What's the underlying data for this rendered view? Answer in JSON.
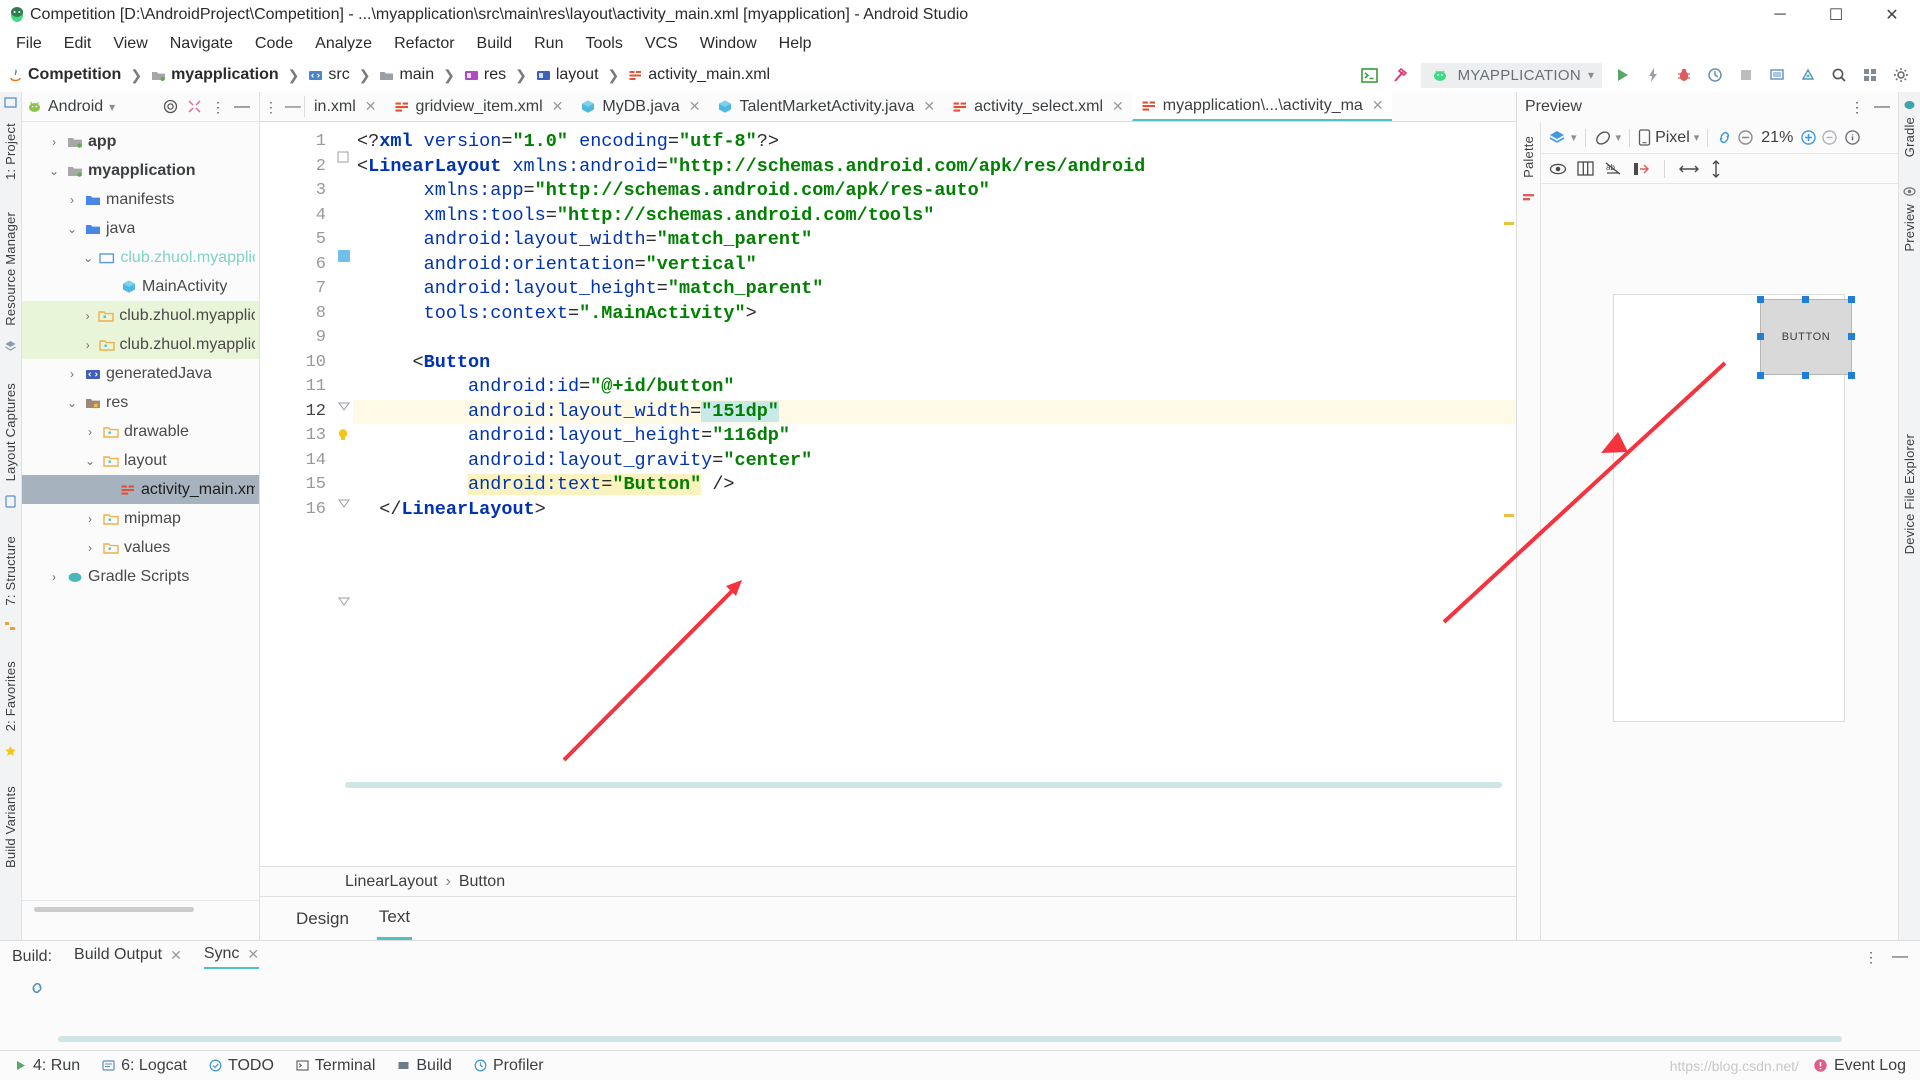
{
  "window": {
    "title": "Competition [D:\\AndroidProject\\Competition] - ...\\myapplication\\src\\main\\res\\layout\\activity_main.xml [myapplication] - Android Studio",
    "minimize_label": "─",
    "maximize_label": "☐",
    "close_label": "✕"
  },
  "menu": {
    "items": [
      {
        "label": "File"
      },
      {
        "label": "Edit"
      },
      {
        "label": "View"
      },
      {
        "label": "Navigate"
      },
      {
        "label": "Code"
      },
      {
        "label": "Analyze"
      },
      {
        "label": "Refactor"
      },
      {
        "label": "Build"
      },
      {
        "label": "Run"
      },
      {
        "label": "Tools"
      },
      {
        "label": "VCS"
      },
      {
        "label": "Window"
      },
      {
        "label": "Help"
      }
    ]
  },
  "breadcrumb": {
    "items": [
      {
        "label": "Competition",
        "icon": "java-icon",
        "bold": true
      },
      {
        "label": "myapplication",
        "icon": "module-icon",
        "bold": true
      },
      {
        "label": "src",
        "icon": "source-folder-icon",
        "bold": false
      },
      {
        "label": "main",
        "icon": "folder-icon",
        "bold": false
      },
      {
        "label": "res",
        "icon": "res-folder-icon",
        "bold": false
      },
      {
        "label": "layout",
        "icon": "layout-folder-icon",
        "bold": false
      },
      {
        "label": "activity_main.xml",
        "icon": "xml-file-icon",
        "bold": false
      }
    ]
  },
  "toolbar": {
    "terminal_icon": "terminal-icon",
    "gradle_icon": "gradle-hammer-icon",
    "device_name": "MYAPPLICATION",
    "device_icon": "android-head-icon",
    "run_icon": "run-play-icon",
    "apply_changes_icon": "lightning-icon",
    "debug_icon": "debug-bug-icon",
    "profile_icon": "profile-icon",
    "stop_icon": "stop-square-icon",
    "avd_icon": "avd-manager-icon",
    "sdk_icon": "sdk-manager-icon",
    "search_icon": "search-icon",
    "layout_icon": "layout-grid-icon",
    "settings_icon": "gear-icon"
  },
  "project_panel": {
    "title": "Android",
    "dropdown_icon": "chevron-down-icon",
    "target_icon": "target-locate-icon",
    "collapse_icon": "collapse-all-icon",
    "more_icon": "more-vertical-icon",
    "hide_icon": "hide-panel-icon",
    "tree": [
      {
        "label": "app",
        "indent": 1,
        "twisty": "›",
        "icon": "module-icon",
        "bold": true,
        "state": "normal"
      },
      {
        "label": "myapplication",
        "indent": 1,
        "twisty": "⌄",
        "icon": "module-icon",
        "bold": true,
        "state": "normal"
      },
      {
        "label": "manifests",
        "indent": 2,
        "twisty": "›",
        "icon": "folder-blue-icon",
        "bold": false,
        "state": "normal"
      },
      {
        "label": "java",
        "indent": 2,
        "twisty": "⌄",
        "icon": "folder-blue-icon",
        "bold": false,
        "state": "normal"
      },
      {
        "label": "club.zhuol.myapplication",
        "indent": 3,
        "twisty": "⌄",
        "icon": "package-icon",
        "bold": false,
        "state": "pkg"
      },
      {
        "label": "MainActivity",
        "indent": 4,
        "twisty": "",
        "icon": "java-class-icon",
        "bold": false,
        "state": "normal"
      },
      {
        "label": "club.zhuol.myapplication (a",
        "indent": 3,
        "twisty": "›",
        "icon": "folder-orange-icon",
        "bold": false,
        "state": "highlight"
      },
      {
        "label": "club.zhuol.myapplication (t",
        "indent": 3,
        "twisty": "›",
        "icon": "folder-orange-icon",
        "bold": false,
        "state": "highlight"
      },
      {
        "label": "generatedJava",
        "indent": 2,
        "twisty": "›",
        "icon": "source-folder-icon",
        "bold": false,
        "state": "normal"
      },
      {
        "label": "res",
        "indent": 2,
        "twisty": "⌄",
        "icon": "res-folder-icon",
        "bold": false,
        "state": "normal"
      },
      {
        "label": "drawable",
        "indent": 3,
        "twisty": "›",
        "icon": "folder-orange-icon",
        "bold": false,
        "state": "normal"
      },
      {
        "label": "layout",
        "indent": 3,
        "twisty": "⌄",
        "icon": "folder-orange-icon",
        "bold": false,
        "state": "normal"
      },
      {
        "label": "activity_main.xml",
        "indent": 4,
        "twisty": "",
        "icon": "xml-file-icon",
        "bold": false,
        "state": "selected"
      },
      {
        "label": "mipmap",
        "indent": 3,
        "twisty": "›",
        "icon": "folder-orange-icon",
        "bold": false,
        "state": "normal"
      },
      {
        "label": "values",
        "indent": 3,
        "twisty": "›",
        "icon": "folder-orange-icon",
        "bold": false,
        "state": "normal"
      },
      {
        "label": "Gradle Scripts",
        "indent": 1,
        "twisty": "›",
        "icon": "gradle-elephant-icon",
        "bold": false,
        "state": "normal"
      }
    ]
  },
  "left_strip": {
    "project_label": "1: Project",
    "resource_manager_label": "Resource Manager",
    "layout_captures_label": "Layout Captures",
    "structure_label": "7: Structure",
    "favorites_label": "2: Favorites",
    "build_variants_label": "Build Variants"
  },
  "right_strip": {
    "gradle_label": "Gradle",
    "preview_label": "Preview",
    "device_file_explorer_label": "Device File Explorer"
  },
  "editor_tabs": [
    {
      "label": "in.xml",
      "icon": "xml-file-icon",
      "active": false,
      "truncated": true
    },
    {
      "label": "gridview_item.xml",
      "icon": "xml-file-icon",
      "active": false
    },
    {
      "label": "MyDB.java",
      "icon": "java-class-icon",
      "active": false
    },
    {
      "label": "TalentMarketActivity.java",
      "icon": "java-class-icon",
      "active": false
    },
    {
      "label": "activity_select.xml",
      "icon": "xml-file-icon",
      "active": false
    },
    {
      "label": "myapplication\\...\\activity_ma",
      "icon": "xml-file-icon",
      "active": true
    }
  ],
  "editor": {
    "lines": [
      {
        "n": 1,
        "html": "<span class='punct'>&lt;?</span><span class='tag'>xml</span> <span class='attr'>version</span><span class='punct'>=</span><span class='str'>\"1.0\"</span> <span class='attr'>encoding</span><span class='punct'>=</span><span class='str'>\"utf-8\"</span><span class='punct'>?&gt;</span>"
      },
      {
        "n": 2,
        "html": "<span class='punct'>&lt;</span><span class='tag'>LinearLayout</span> <span class='attr'>xmlns:android</span><span class='punct'>=</span><span class='str'>\"http://schemas.android.com/apk/res/android</span>"
      },
      {
        "n": 3,
        "html": "      <span class='attr'>xmlns:app</span><span class='punct'>=</span><span class='str'>\"http://schemas.android.com/apk/res-auto\"</span>"
      },
      {
        "n": 4,
        "html": "      <span class='attr'>xmlns:tools</span><span class='punct'>=</span><span class='str'>\"http://schemas.android.com/tools\"</span>"
      },
      {
        "n": 5,
        "html": "      <span class='attr'>android:layout_width</span><span class='punct'>=</span><span class='str'>\"match_parent\"</span>"
      },
      {
        "n": 6,
        "html": "      <span class='attr'>android:orientation</span><span class='punct'>=</span><span class='str'>\"vertical\"</span>"
      },
      {
        "n": 7,
        "html": "      <span class='attr'>android:layout_height</span><span class='punct'>=</span><span class='str'>\"match_parent\"</span>"
      },
      {
        "n": 8,
        "html": "      <span class='attr'>tools:context</span><span class='punct'>=</span><span class='str'>\".MainActivity\"</span><span class='punct'>&gt;</span>"
      },
      {
        "n": 9,
        "html": ""
      },
      {
        "n": 10,
        "html": "     <span class='punct'>&lt;</span><span class='tag'>Button</span>"
      },
      {
        "n": 11,
        "html": "          <span class='attr'>android:id</span><span class='punct'>=</span><span class='str'>\"@+id/button\"</span>"
      },
      {
        "n": 12,
        "html": "          <span class='attr'>android:layout_width</span><span class='punct'>=</span><span class='selstr'><span class='str'>\"151dp\"</span></span>",
        "current": true
      },
      {
        "n": 13,
        "html": "          <span class='attr'>android:layout_height</span><span class='punct'>=</span><span class='str'>\"116dp\"</span>"
      },
      {
        "n": 14,
        "html": "          <span class='attr'>android:layout_gravity</span><span class='punct'>=</span><span class='str'>\"center\"</span>"
      },
      {
        "n": 15,
        "html": "          <span class='selyellow'><span class='attr'>android:text</span><span class='punct'>=</span><span class='str'>\"Button\"</span></span> <span class='punct'>/&gt;</span>"
      },
      {
        "n": 16,
        "html": "  <span class='punct'>&lt;/</span><span class='tag'>LinearLayout</span><span class='punct'>&gt;</span>"
      }
    ],
    "current_line": 12,
    "bulb_icon": "intention-bulb-icon",
    "component_path": [
      "LinearLayout",
      "Button"
    ],
    "view_tabs": [
      {
        "label": "Design",
        "active": false
      },
      {
        "label": "Text",
        "active": true
      }
    ]
  },
  "preview": {
    "title": "Preview",
    "more_icon": "more-vertical-icon",
    "hide_icon": "hide-panel-icon",
    "palette_label": "Palette",
    "design_mode_icon": "layers-icon",
    "orientation_icon": "rotate-icon",
    "device_icon": "device-phone-icon",
    "device_name": "Pixel",
    "link_icon": "link-icon",
    "zoom_out_icon": "zoom-out-icon",
    "zoom_level": "21%",
    "zoom_in_icon": "zoom-in-icon",
    "zoom_fit_icon": "zoom-fit-icon",
    "info_icon": "info-icon",
    "tools": [
      {
        "icon": "eye-icon",
        "name": "show-blueprint-toggle"
      },
      {
        "icon": "columns-icon",
        "name": "constraints-toggle"
      },
      {
        "icon": "no-autoconnect-icon",
        "name": "autoconnect-toggle"
      },
      {
        "icon": "clear-constraints-icon",
        "name": "clear-constraints-button"
      },
      {
        "icon": "horizontal-arrows-icon",
        "name": "expand-horizontal-button"
      },
      {
        "icon": "vertical-arrows-icon",
        "name": "expand-vertical-button"
      }
    ],
    "selected_widget_label": "BUTTON"
  },
  "build_panel": {
    "build_label": "Build:",
    "tabs": [
      {
        "label": "Build Output",
        "active": false,
        "close": "✕"
      },
      {
        "label": "Sync",
        "active": true,
        "close": "✕"
      }
    ],
    "more_icon": "more-vertical-icon",
    "hide_icon": "hide-panel-icon",
    "link_icon": "link-chain-icon"
  },
  "status_bar": {
    "items": [
      {
        "label": "4: Run",
        "icon": "run-play-icon"
      },
      {
        "label": "6: Logcat",
        "icon": "logcat-icon"
      },
      {
        "label": "TODO",
        "icon": "todo-icon"
      },
      {
        "label": "Terminal",
        "icon": "terminal-icon"
      },
      {
        "label": "Build",
        "icon": "build-icon"
      },
      {
        "label": "Profiler",
        "icon": "profiler-icon"
      }
    ],
    "watermark": "https://blog.csdn.net/",
    "event_log_label": "Event Log",
    "event_log_icon": "event-log-icon"
  },
  "annotation": {
    "arrow_color": "#f5333f",
    "arrow_name": "red-pointer-arrow"
  },
  "colors": {
    "accent_teal": "#4fc3c3",
    "selection_blue": "#a6b2bd",
    "highlight_green": "#e8f5d8",
    "current_line_yellow": "#fffae6",
    "string_green": "#008000",
    "tag_blue": "#0033b3"
  }
}
